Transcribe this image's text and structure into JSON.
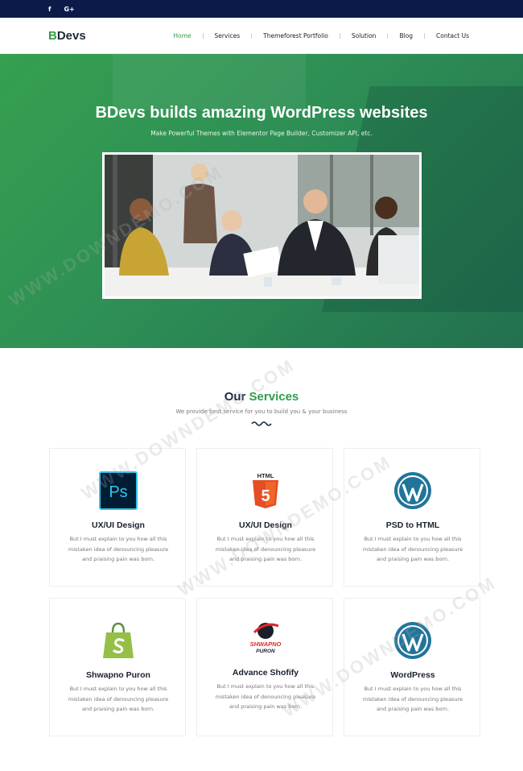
{
  "topbar": {
    "social": [
      {
        "icon": "facebook-icon",
        "glyph": "f"
      },
      {
        "icon": "google-plus-icon",
        "glyph": "G+"
      }
    ],
    "bg_color": "#0c1a4a"
  },
  "header": {
    "logo_b": "B",
    "logo_rest": "Devs",
    "nav": [
      "Home",
      "Services",
      "Themeforest Portfolio",
      "Solution",
      "Blog",
      "Contact Us"
    ],
    "active": "Home"
  },
  "hero": {
    "title": "BDevs builds amazing WordPress websites",
    "subtitle": "Make Powerful Themes with Elementor Page Builder, Customizer API, etc.",
    "image_alt": "team-meeting-photo",
    "bg_color": "#2e8f55"
  },
  "services": {
    "title_plain": "Our",
    "title_accent": "Services",
    "subtitle": "We provide best service for you to build you & your business",
    "accent_color": "#2e9e48",
    "cards": [
      {
        "icon": "photoshop-icon",
        "title": "UX/UI Design",
        "desc": "But I must explain to you how all this mistaken idea of denouncing pleasure and praising pain was born."
      },
      {
        "icon": "html5-icon",
        "title": "UX/UI Design",
        "desc": "But I must explain to you how all this mistaken idea of denouncing pleasure and praising pain was born."
      },
      {
        "icon": "wordpress-icon",
        "title": "PSD to HTML",
        "desc": "But I must explain to you how all this mistaken idea of denouncing pleasure and praising pain was born."
      },
      {
        "icon": "shopify-icon",
        "title": "Shwapno Puron",
        "desc": "But I must explain to you how all this mistaken idea of denouncing pleasure and praising pain was born."
      },
      {
        "icon": "shwapno-puron-logo-icon",
        "title": "Advance Shofify",
        "desc": "But I must explain to you how all this mistaken idea of denouncing pleasure and praising pain was born."
      },
      {
        "icon": "wordpress-icon",
        "title": "WordPress",
        "desc": "But I must explain to you how all this mistaken idea of denouncing pleasure and praising pain was born."
      }
    ],
    "icon_labels": {
      "ps": "Ps",
      "html": "HTML",
      "html_num": "5",
      "shwapno_1": "SHWAPNO",
      "shwapno_2": "PURON"
    }
  },
  "watermark": {
    "text": "WWW.DOWNDEMO.COM"
  }
}
